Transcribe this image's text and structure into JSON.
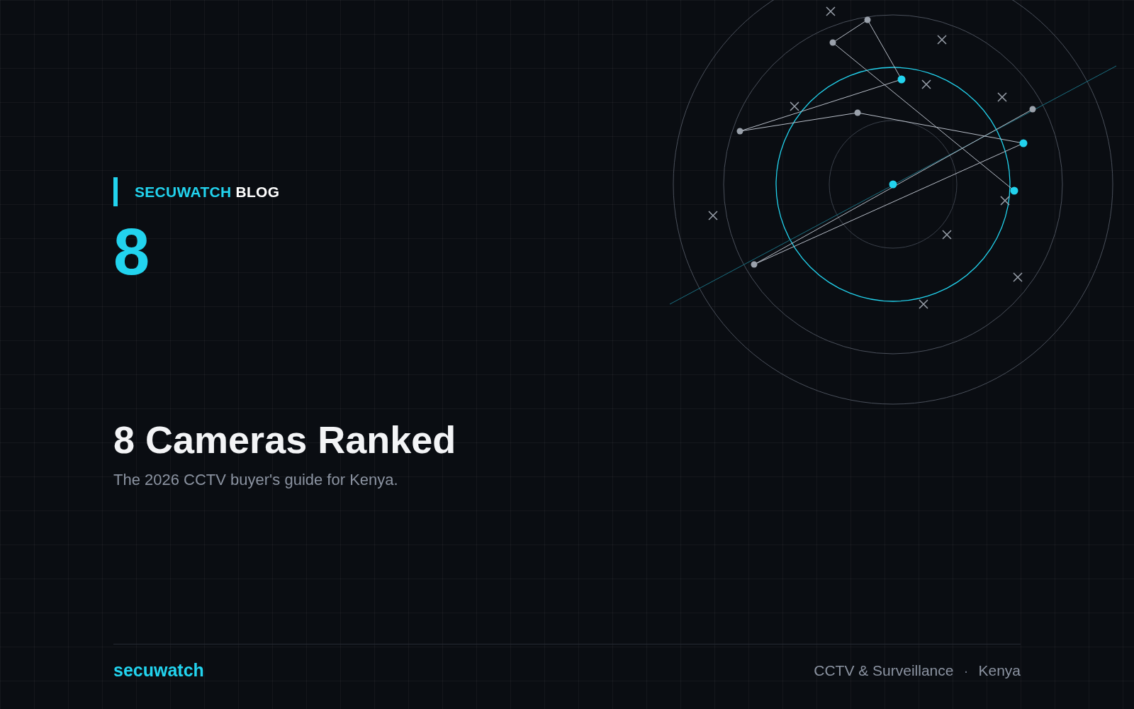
{
  "brand": {
    "accent": "SECUWATCH",
    "rest": "BLOG"
  },
  "number": "8",
  "title": "8 Cameras Ranked",
  "subtitle": "The 2026 CCTV buyer's guide for Kenya.",
  "footer": {
    "logo": "secuwatch",
    "tags": [
      "CCTV & Surveillance",
      "Kenya"
    ],
    "separator": "·"
  }
}
